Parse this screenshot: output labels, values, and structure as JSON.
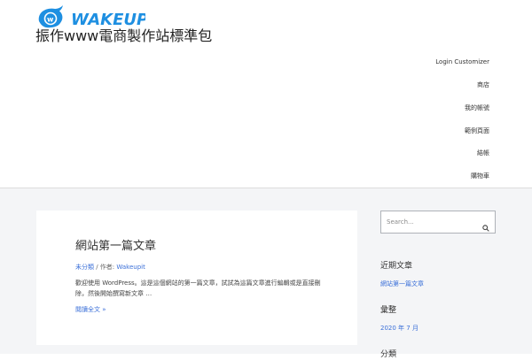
{
  "header": {
    "logo_text": "WAKEUP",
    "site_title": "振作www電商製作站標準包",
    "nav": [
      "Login Customizer",
      "商店",
      "我的帳號",
      "範例頁面",
      "結帳",
      "購物車"
    ]
  },
  "post": {
    "title": "網站第一篇文章",
    "category": "未分類",
    "author_prefix": " / 作者: ",
    "author": "Wakeupit",
    "excerpt": "歡迎使用 WordPress。這是這個網站的第一篇文章，試試為這篇文章進行編輯或是直接刪除，然後開始撰寫新文章 …",
    "read_more": "閱讀全文 »"
  },
  "sidebar": {
    "search_placeholder": "Search...",
    "recent_posts_title": "近期文章",
    "recent_posts": [
      "網站第一篇文章"
    ],
    "archives_title": "彙整",
    "archives": [
      "2020 年 7 月"
    ],
    "categories_title": "分類"
  },
  "colors": {
    "link": "#3a6fd8",
    "logo_blue": "#1e8fe1",
    "content_bg": "#f4f5f7"
  }
}
